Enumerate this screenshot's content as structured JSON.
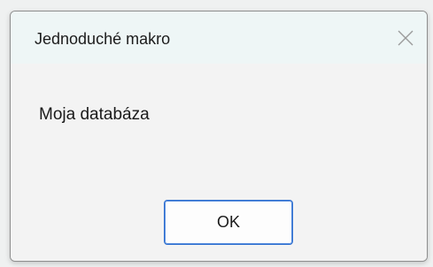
{
  "dialog": {
    "title": "Jednoduché makro",
    "close_icon": "close-icon",
    "message": "Moja databáza",
    "ok_label": "OK"
  },
  "colors": {
    "titlebar_bg": "#eef6f6",
    "body_bg": "#f3f3f3",
    "button_border": "#2f6fcf"
  }
}
